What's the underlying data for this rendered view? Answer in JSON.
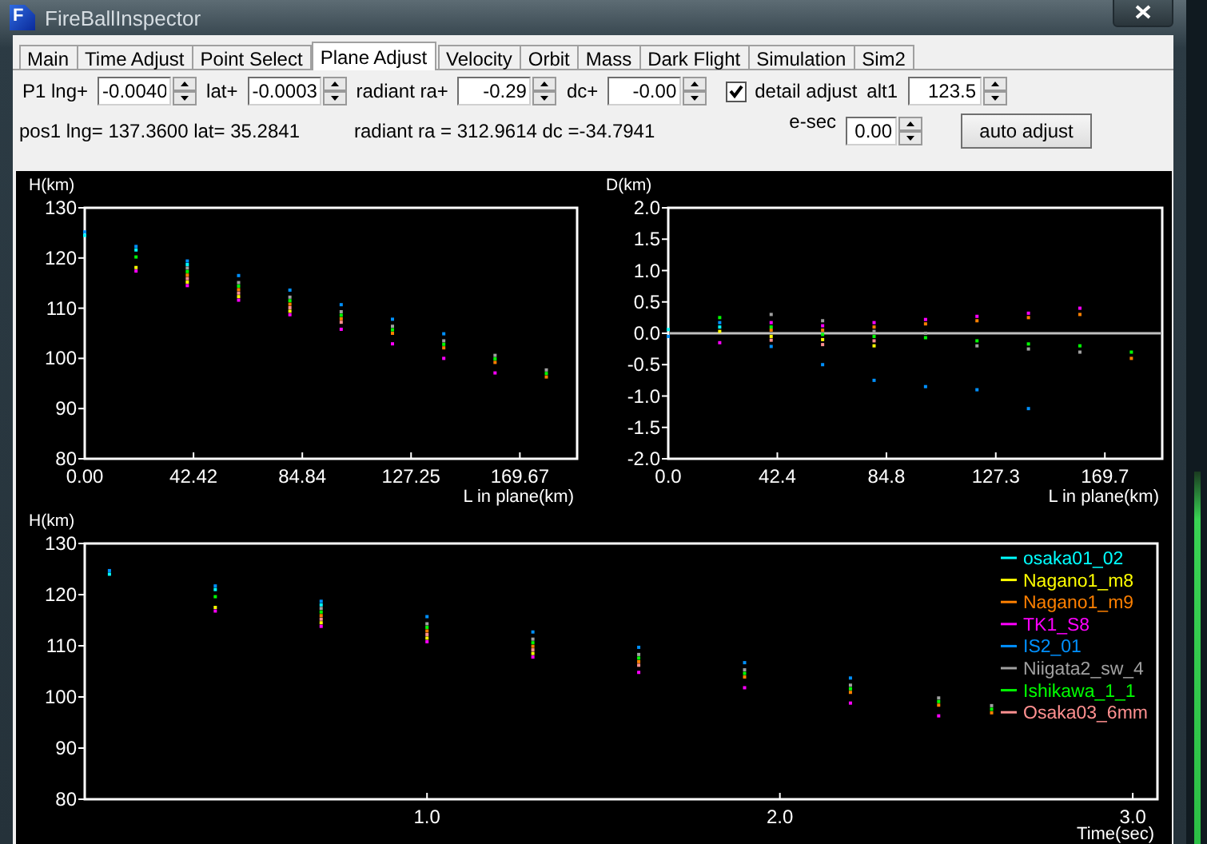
{
  "window": {
    "title": "FireBallInspector",
    "icon_letter": "F"
  },
  "tabs": [
    {
      "label": "Main",
      "selected": false
    },
    {
      "label": "Time Adjust",
      "selected": false
    },
    {
      "label": "Point Select",
      "selected": false
    },
    {
      "label": "Plane Adjust",
      "selected": true
    },
    {
      "label": "Velocity",
      "selected": false
    },
    {
      "label": "Orbit",
      "selected": false
    },
    {
      "label": "Mass",
      "selected": false
    },
    {
      "label": "Dark Flight",
      "selected": false
    },
    {
      "label": "Simulation",
      "selected": false
    },
    {
      "label": "Sim2",
      "selected": false
    }
  ],
  "adjust_row": [
    {
      "kind": "label",
      "text": "P1 lng+"
    },
    {
      "kind": "spin",
      "value": "-0.0040"
    },
    {
      "kind": "label",
      "text": "lat+"
    },
    {
      "kind": "spin",
      "value": "-0.0003"
    },
    {
      "kind": "label",
      "text": "radiant ra+"
    },
    {
      "kind": "spin",
      "value": "-0.29"
    },
    {
      "kind": "label",
      "text": "dc+"
    },
    {
      "kind": "spin",
      "value": "-0.00"
    },
    {
      "kind": "checkbox",
      "label": "detail adjust",
      "checked": true
    },
    {
      "kind": "label",
      "text": "alt1"
    },
    {
      "kind": "spin",
      "value": "123.5"
    }
  ],
  "info_row": [
    {
      "kind": "text",
      "text": "pos1 lng= 137.3600  lat= 35.2841"
    },
    {
      "kind": "text",
      "text": "radiant ra = 312.9614  dc =-34.7941"
    },
    {
      "kind": "label",
      "text": "e-sec"
    },
    {
      "kind": "spin",
      "value": "0.00"
    },
    {
      "kind": "button",
      "label": "auto adjust"
    }
  ],
  "charts": [
    {
      "chart_data": {
        "type": "scatter",
        "ylabel": "H(km)",
        "xlabel": "L in plane(km)",
        "x": [
          0,
          20,
          40,
          60,
          80,
          100,
          120,
          140,
          160,
          180
        ],
        "xlim": [
          0,
          192
        ],
        "ylim": [
          80,
          130
        ],
        "xticks": [
          {
            "value": 0,
            "label": "0.00"
          },
          {
            "value": 42.42,
            "label": "42.42"
          },
          {
            "value": 84.84,
            "label": "84.84"
          },
          {
            "value": 127.25,
            "label": "127.25"
          },
          {
            "value": 169.67,
            "label": "169.67"
          }
        ],
        "yticks": [
          80,
          90,
          100,
          110,
          120,
          130
        ],
        "series": [
          {
            "color": "#00ffff",
            "values": [
              124.5,
              121.6,
              118.7,
              null,
              null,
              null,
              null,
              null,
              null,
              null
            ]
          },
          {
            "color": "#ffff00",
            "values": [
              null,
              118.1,
              115.2,
              112.3,
              109.4,
              null,
              null,
              null,
              null,
              null
            ]
          },
          {
            "color": "#ff8000",
            "values": [
              null,
              null,
              116.6,
              113.7,
              110.8,
              107.9,
              105.0,
              102.1,
              99.2,
              96.3
            ]
          },
          {
            "color": "#ff00ff",
            "values": [
              null,
              117.4,
              114.5,
              111.6,
              108.7,
              105.8,
              102.9,
              100.0,
              97.1,
              null
            ]
          },
          {
            "color": "#0090ff",
            "values": [
              125.2,
              122.3,
              119.4,
              116.5,
              113.6,
              110.7,
              107.8,
              104.9,
              null,
              null
            ]
          },
          {
            "color": "#a0a0a0",
            "values": [
              null,
              null,
              118.0,
              115.1,
              112.2,
              109.3,
              106.4,
              103.5,
              100.6,
              97.7
            ]
          },
          {
            "color": "#00ff00",
            "values": [
              null,
              120.2,
              117.3,
              114.4,
              111.5,
              108.6,
              105.7,
              102.8,
              99.9,
              97.0
            ]
          },
          {
            "color": "#ff9090",
            "values": [
              null,
              null,
              115.9,
              113.0,
              110.1,
              107.2,
              null,
              null,
              null,
              null
            ]
          }
        ]
      }
    },
    {
      "chart_data": {
        "type": "scatter",
        "ylabel": "D(km)",
        "xlabel": "L in plane(km)",
        "x": [
          0,
          20,
          40,
          60,
          80,
          100,
          120,
          140,
          160,
          180
        ],
        "xlim": [
          0,
          192
        ],
        "ylim": [
          -2,
          2
        ],
        "xticks": [
          {
            "value": 0,
            "label": "0.0"
          },
          {
            "value": 42.4,
            "label": "42.4"
          },
          {
            "value": 84.8,
            "label": "84.8"
          },
          {
            "value": 127.3,
            "label": "127.3"
          },
          {
            "value": 169.7,
            "label": "169.7"
          }
        ],
        "yticks": [
          {
            "value": 2,
            "label": "2.0"
          },
          {
            "value": 1.5,
            "label": "1.5"
          },
          {
            "value": 1,
            "label": "1.0"
          },
          {
            "value": 0.5,
            "label": "0.5"
          },
          {
            "value": 0,
            "label": "0.0"
          },
          {
            "value": -0.5,
            "label": "-0.5"
          },
          {
            "value": -1,
            "label": "-1.0"
          },
          {
            "value": -1.5,
            "label": "-1.5"
          },
          {
            "value": -2,
            "label": "-2.0"
          }
        ],
        "series": [
          {
            "color": "#00ffff",
            "values": [
              0.06,
              0.1,
              null,
              null,
              null,
              null,
              null,
              null,
              null,
              null
            ]
          },
          {
            "color": "#ffff00",
            "values": [
              null,
              0.03,
              -0.05,
              -0.1,
              -0.2,
              null,
              null,
              null,
              null,
              null
            ]
          },
          {
            "color": "#ff8000",
            "values": [
              null,
              null,
              0.05,
              0.05,
              0.1,
              0.15,
              0.2,
              0.25,
              0.3,
              -0.4
            ]
          },
          {
            "color": "#ff00ff",
            "values": [
              null,
              -0.15,
              0.17,
              0.12,
              0.17,
              0.22,
              0.27,
              0.32,
              0.4,
              null
            ]
          },
          {
            "color": "#0090ff",
            "values": [
              -0.05,
              0.17,
              -0.21,
              -0.5,
              -0.75,
              -0.85,
              -0.9,
              -1.2,
              null,
              null
            ]
          },
          {
            "color": "#a0a0a0",
            "values": [
              null,
              null,
              0.3,
              0.2,
              0.03,
              0.0,
              -0.2,
              -0.25,
              -0.3,
              null
            ]
          },
          {
            "color": "#00ff00",
            "values": [
              null,
              0.25,
              0.1,
              -0.02,
              -0.05,
              -0.07,
              -0.12,
              -0.17,
              -0.2,
              -0.3
            ]
          },
          {
            "color": "#ff9090",
            "values": [
              null,
              null,
              -0.11,
              -0.18,
              -0.12,
              null,
              null,
              null,
              null,
              null
            ]
          }
        ]
      }
    },
    {
      "chart_data": {
        "type": "scatter",
        "ylabel": "H(km)",
        "xlabel": "Time(sec)",
        "x": [
          0.1,
          0.4,
          0.7,
          1.0,
          1.3,
          1.6,
          1.9,
          2.2,
          2.45,
          2.6
        ],
        "xlim": [
          0.03,
          3.07
        ],
        "ylim": [
          80,
          130
        ],
        "xticks": [
          {
            "value": 1,
            "label": "1.0"
          },
          {
            "value": 2,
            "label": "2.0"
          },
          {
            "value": 3,
            "label": "3.0"
          }
        ],
        "yticks": [
          80,
          90,
          100,
          110,
          120,
          130
        ],
        "legend": "upper right",
        "series": [
          {
            "name": "osaka01_02",
            "color": "#00ffff",
            "values": [
              124.0,
              121.0,
              118.0,
              null,
              null,
              null,
              null,
              null,
              null,
              null
            ]
          },
          {
            "name": "Nagano1_m8",
            "color": "#ffff00",
            "values": [
              null,
              117.5,
              114.5,
              111.5,
              108.5,
              null,
              null,
              null,
              null,
              null
            ]
          },
          {
            "name": "Nagano1_m9",
            "color": "#ff8000",
            "values": [
              null,
              null,
              115.9,
              112.9,
              109.9,
              106.9,
              103.9,
              100.9,
              98.4,
              96.9
            ]
          },
          {
            "name": "TK1_S8",
            "color": "#ff00ff",
            "values": [
              null,
              116.8,
              113.8,
              110.8,
              107.8,
              104.8,
              101.8,
              98.8,
              96.3,
              null
            ]
          },
          {
            "name": "IS2_01",
            "color": "#0090ff",
            "values": [
              124.7,
              121.7,
              118.7,
              115.7,
              112.7,
              109.7,
              106.7,
              103.7,
              null,
              null
            ]
          },
          {
            "name": "Niigata2_sw_4",
            "color": "#a0a0a0",
            "values": [
              null,
              null,
              117.3,
              114.3,
              111.3,
              108.3,
              105.3,
              102.3,
              99.8,
              98.3
            ]
          },
          {
            "name": "Ishikawa_1_1",
            "color": "#00ff00",
            "values": [
              null,
              119.6,
              116.6,
              113.6,
              110.6,
              107.6,
              104.6,
              101.6,
              99.1,
              97.6
            ]
          },
          {
            "name": "Osaka03_6mm",
            "color": "#ff9090",
            "values": [
              null,
              null,
              115.2,
              112.2,
              109.2,
              106.2,
              null,
              null,
              null,
              null
            ]
          }
        ]
      }
    }
  ]
}
